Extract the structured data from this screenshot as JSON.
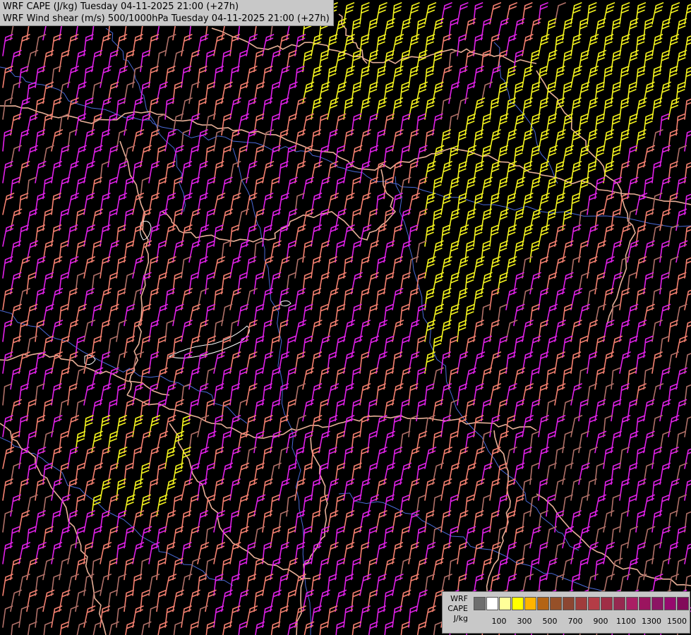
{
  "header": {
    "line1": "WRF CAPE (J/kg) Tuesday 04-11-2025 21:00 (+27h)",
    "line2": "WRF Wind shear (m/s) 500/1000hPa Tuesday 04-11-2025 21:00 (+27h)"
  },
  "legend": {
    "label_model": "WRF",
    "label_field": "CAPE",
    "label_unit": "J/kg",
    "colors": [
      "#6e6e6e",
      "#ffffff",
      "#ffff99",
      "#ffff00",
      "#ffb400",
      "#b46414",
      "#965028",
      "#8c4632",
      "#a03c3c",
      "#b43c46",
      "#a02d46",
      "#962850",
      "#aa1e64",
      "#9b145f",
      "#8c1464",
      "#960a6e",
      "#820a5a"
    ],
    "ticks": [
      "100",
      "300",
      "500",
      "700",
      "900",
      "1100",
      "1300",
      "1500"
    ]
  },
  "barb_colors": {
    "magenta": "#e020e8",
    "salmon": "#f58070",
    "yellow": "#f5f51e",
    "dim": "#b07068"
  },
  "borders": {
    "country": "#e8b098",
    "river": "#4a6ad8",
    "lake": "#ffffff"
  }
}
